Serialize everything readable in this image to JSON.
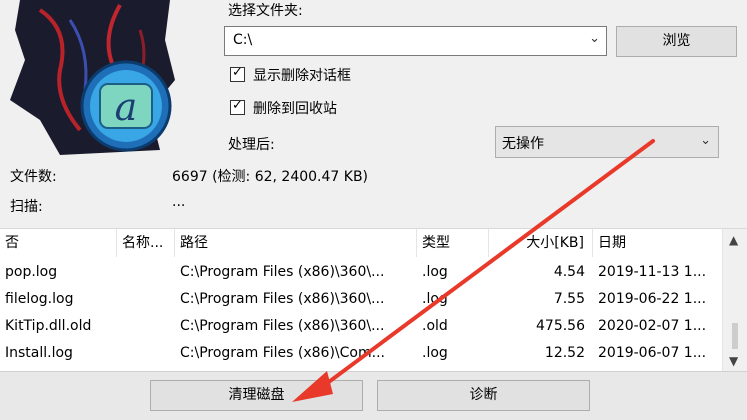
{
  "folder": {
    "label": "选择文件夹:",
    "value": "C:\\",
    "browse_label": "浏览"
  },
  "options": {
    "show_delete_dialog": {
      "label": "显示删除对话框",
      "checked": true
    },
    "delete_to_recycle": {
      "label": "删除到回收站",
      "checked": true
    }
  },
  "after": {
    "label": "处理后:",
    "value": "无操作"
  },
  "stats": {
    "files_label": "文件数:",
    "files_value": "6697 (检测: 62, 2400.47 KB)",
    "scan_label": "扫描:",
    "scan_value": "..."
  },
  "table": {
    "columns": [
      "否",
      "名称...",
      "路径",
      "类型",
      "大小[KB]",
      "日期"
    ],
    "rows": [
      {
        "name": "pop.log",
        "path": "C:\\Program Files (x86)\\360\\...",
        "type": ".log",
        "size": "4.54",
        "date": "2019-11-13 1..."
      },
      {
        "name": "filelog.log",
        "path": "C:\\Program Files (x86)\\360\\...",
        "type": ".log",
        "size": "7.55",
        "date": "2019-06-22 1..."
      },
      {
        "name": "KitTip.dll.old",
        "path": "C:\\Program Files (x86)\\360\\...",
        "type": ".old",
        "size": "475.56",
        "date": "2020-02-07 1..."
      },
      {
        "name": "Install.log",
        "path": "C:\\Program Files (x86)\\Com...",
        "type": ".log",
        "size": "12.52",
        "date": "2019-06-07 1..."
      }
    ]
  },
  "actions": {
    "clean_label": "清理磁盘",
    "diagnose_label": "诊断"
  },
  "colors": {
    "annotation_arrow": "#e8392a",
    "logo_circle": "#2a8fd6"
  }
}
